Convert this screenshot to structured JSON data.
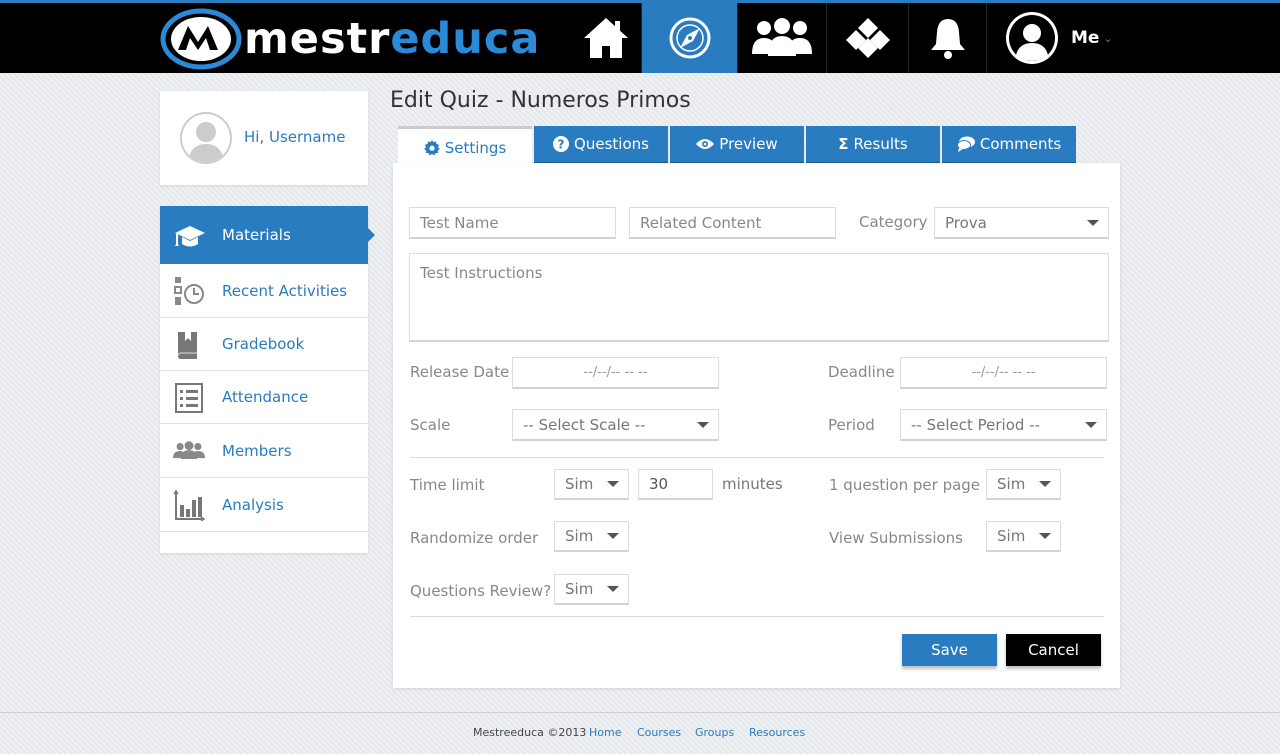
{
  "header": {
    "logo_part1": "mestr",
    "logo_part2": "educa",
    "nav": [
      {
        "icon": "home-icon"
      },
      {
        "icon": "compass-icon",
        "active": true
      },
      {
        "icon": "group-icon"
      },
      {
        "icon": "diamond-grid-icon"
      },
      {
        "icon": "bell-icon"
      }
    ],
    "me_label": "Me"
  },
  "profile": {
    "greeting": "Hi, Username"
  },
  "sidebar": {
    "items": [
      {
        "label": "Materials",
        "icon": "graduation-cap-icon",
        "active": true
      },
      {
        "label": "Recent Activities",
        "icon": "recent-activities-icon"
      },
      {
        "label": "Gradebook",
        "icon": "book-icon"
      },
      {
        "label": "Attendance",
        "icon": "list-icon"
      },
      {
        "label": "Members",
        "icon": "members-icon"
      },
      {
        "label": "Analysis",
        "icon": "bar-chart-icon"
      }
    ]
  },
  "page": {
    "title": "Edit Quiz - Numeros Primos"
  },
  "tabs": [
    {
      "label": "Settings",
      "icon": "gear-icon",
      "active": true
    },
    {
      "label": "Questions",
      "icon": "question-icon"
    },
    {
      "label": "Preview",
      "icon": "eye-icon"
    },
    {
      "label": "Results",
      "icon": "sigma-icon"
    },
    {
      "label": "Comments",
      "icon": "comment-icon"
    }
  ],
  "form": {
    "test_name_placeholder": "Test Name",
    "related_content_placeholder": "Related Content",
    "category_label": "Category",
    "category_value": "Prova",
    "instructions_placeholder": "Test Instructions",
    "release_date_label": "Release Date",
    "release_date_value": "--/--/-- -- --",
    "deadline_label": "Deadline",
    "deadline_value": "--/--/-- -- --",
    "scale_label": "Scale",
    "scale_value": "-- Select Scale --",
    "period_label": "Period",
    "period_value": "-- Select Period --",
    "time_limit_label": "Time limit",
    "time_limit_toggle": "Sim",
    "time_limit_value": "30",
    "time_limit_unit": "minutes",
    "question_per_page_label": "1 question per page",
    "question_per_page_value": "Sim",
    "randomize_label": "Randomize order",
    "randomize_value": "Sim",
    "view_submissions_label": "View Submissions",
    "view_submissions_value": "Sim",
    "questions_review_label": "Questions Review?",
    "questions_review_value": "Sim",
    "save_label": "Save",
    "cancel_label": "Cancel"
  },
  "footer": {
    "copyright": "Mestreeduca ©2013",
    "links": [
      "Home",
      "Courses",
      "Groups",
      "Resources"
    ]
  },
  "colors": {
    "accent": "#2a7cc0",
    "topbar": "#000000"
  }
}
